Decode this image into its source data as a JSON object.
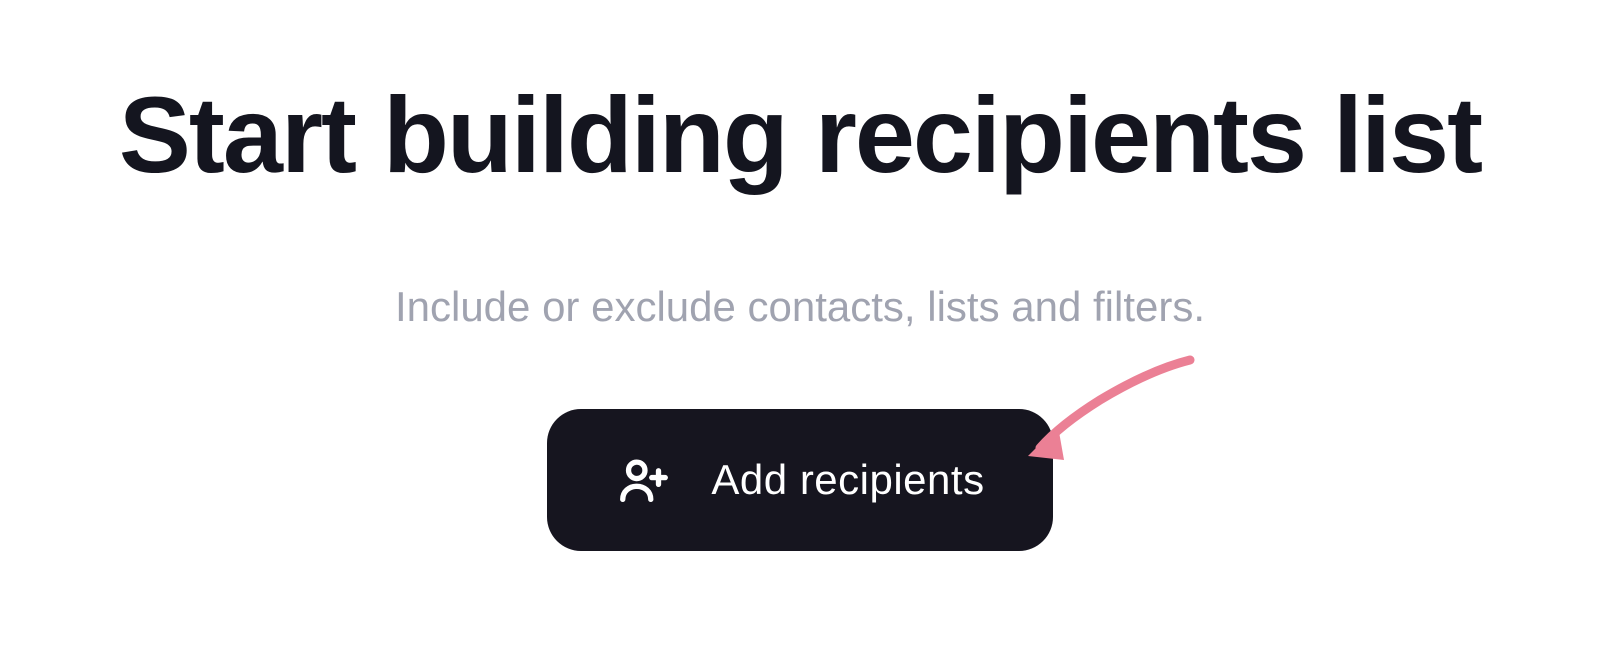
{
  "heading": "Start building recipients list",
  "subtitle": "Include or exclude contacts, lists and filters.",
  "button": {
    "label": "Add recipients",
    "icon": "user-plus-icon"
  },
  "colors": {
    "text_primary": "#14151f",
    "text_secondary": "#a0a3b0",
    "button_bg": "#16151f",
    "button_text": "#ffffff",
    "annotation": "#eb8095"
  }
}
